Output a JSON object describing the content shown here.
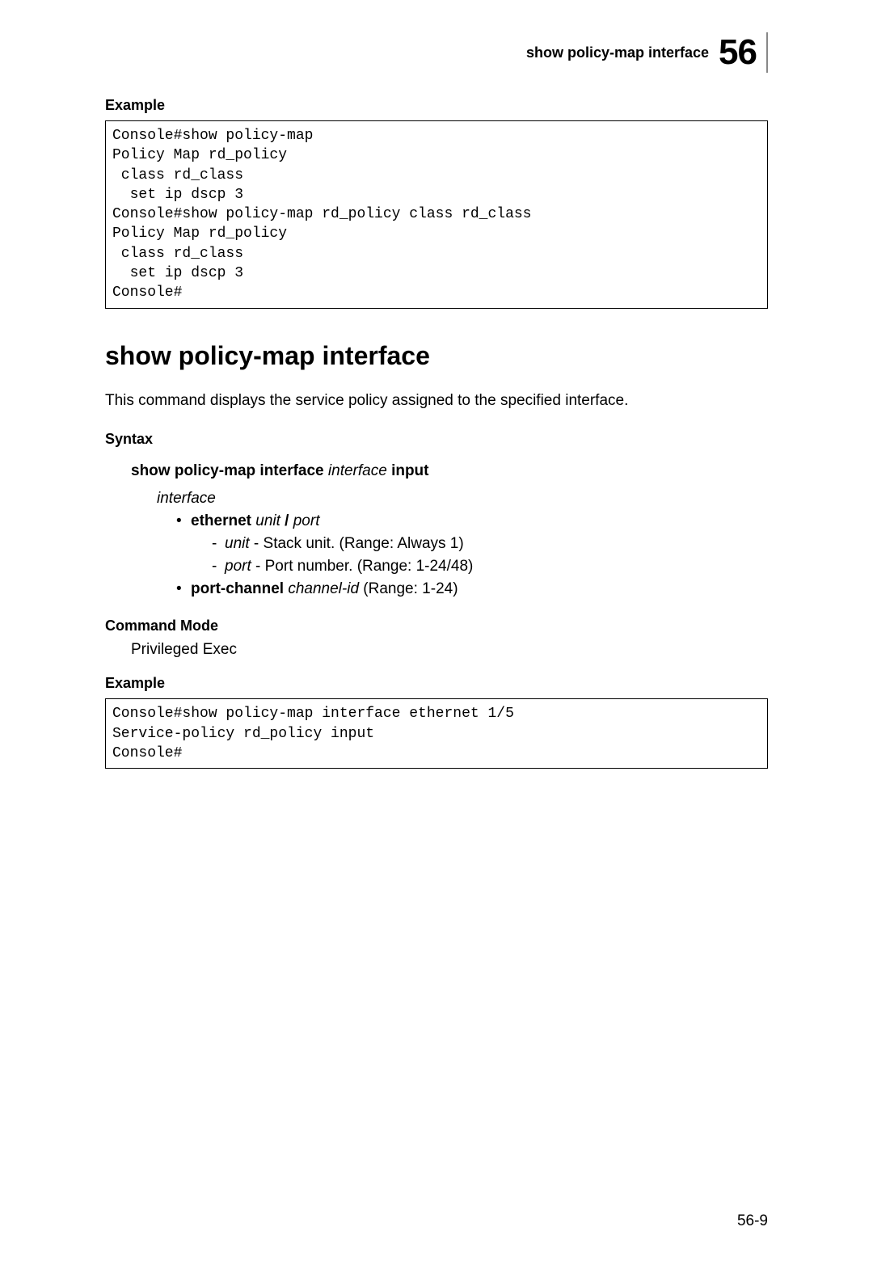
{
  "header": {
    "breadcrumb": "show policy-map interface",
    "chapter_number": "56"
  },
  "sections": {
    "example1_label": "Example",
    "example1_code": "Console#show policy-map\nPolicy Map rd_policy\n class rd_class\n  set ip dscp 3\nConsole#show policy-map rd_policy class rd_class\nPolicy Map rd_policy\n class rd_class\n  set ip dscp 3\nConsole#",
    "main_heading": "show policy-map interface",
    "description": "This command displays the service policy assigned to the specified interface.",
    "syntax_label": "Syntax",
    "syntax": {
      "cmd_bold1": "show policy-map interface",
      "cmd_italic": "interface",
      "cmd_bold2": "input",
      "param_head": "interface",
      "ethernet_bold": "ethernet",
      "ethernet_italic": "unit",
      "ethernet_slash": "/",
      "ethernet_italic2": "port",
      "unit_italic": "unit",
      "unit_text": " - Stack unit. (Range: Always 1)",
      "port_italic": "port",
      "port_text": " - Port number. (Range: 1-24/48)",
      "portchannel_bold": "port-channel",
      "portchannel_italic": "channel-id",
      "portchannel_text": " (Range: 1-24)"
    },
    "command_mode_label": "Command Mode",
    "command_mode_value": "Privileged Exec",
    "example2_label": "Example",
    "example2_code": "Console#show policy-map interface ethernet 1/5\nService-policy rd_policy input\nConsole#"
  },
  "footer": {
    "page": "56-9"
  }
}
